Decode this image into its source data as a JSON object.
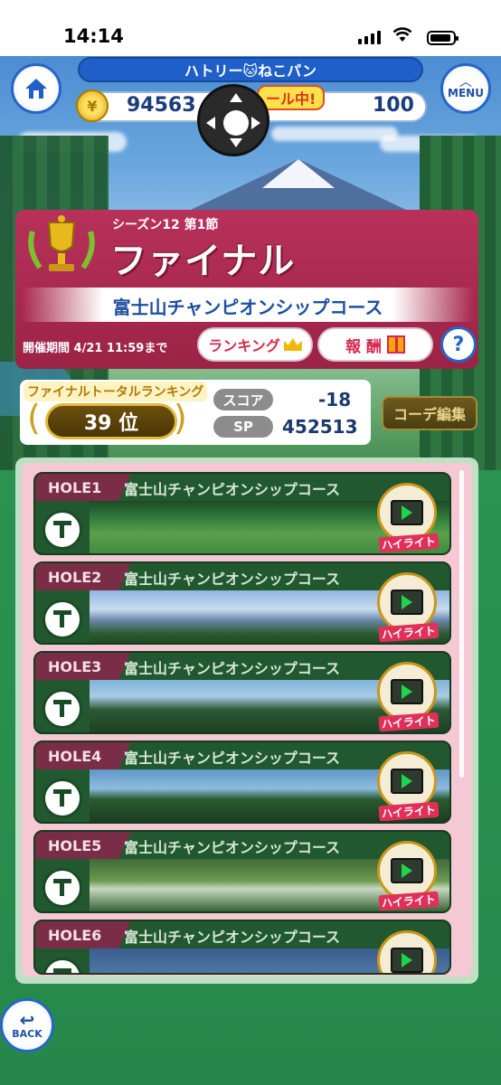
{
  "status_bar": {
    "time": "14:14"
  },
  "header": {
    "player_name": "ハトリー🐱ねこパン",
    "coins": "94563",
    "sale_text": "ール中!",
    "gems": "100",
    "menu_label": "MENU"
  },
  "event": {
    "season": "シーズン12 第1節",
    "title": "ファイナル",
    "course": "富士山チャンピオンシップコース",
    "period": "開催期間 4/21 11:59まで",
    "ranking_button": "ランキング",
    "reward_button": "報 酬",
    "help": "?"
  },
  "ranking": {
    "label": "ファイナルトータルランキング",
    "rank": "39 位",
    "score_label": "スコア",
    "score": "-18",
    "sp_label": "SP",
    "sp": "452513",
    "code_button": "コーデ編集"
  },
  "holes": [
    {
      "hole": "HOLE1",
      "course": "富士山チャンピオンシップコース",
      "highlight": "ハイライト"
    },
    {
      "hole": "HOLE2",
      "course": "富士山チャンピオンシップコース",
      "highlight": "ハイライト"
    },
    {
      "hole": "HOLE3",
      "course": "富士山チャンピオンシップコース",
      "highlight": "ハイライト"
    },
    {
      "hole": "HOLE4",
      "course": "富士山チャンピオンシップコース",
      "highlight": "ハイライト"
    },
    {
      "hole": "HOLE5",
      "course": "富士山チャンピオンシップコース",
      "highlight": "ハイライト"
    },
    {
      "hole": "HOLE6",
      "course": "富士山チャンピオンシップコース",
      "highlight": ""
    }
  ],
  "back_label": "BACK",
  "colors": {
    "accent_blue": "#2765c6",
    "event_red": "#b8315a",
    "field_green": "#2f9c57"
  },
  "icons": [
    "home-icon",
    "coin-icon",
    "dpad-icon",
    "trophy-icon",
    "crown-icon",
    "gift-icon",
    "tee-icon",
    "play-icon",
    "back-arrow-icon"
  ]
}
